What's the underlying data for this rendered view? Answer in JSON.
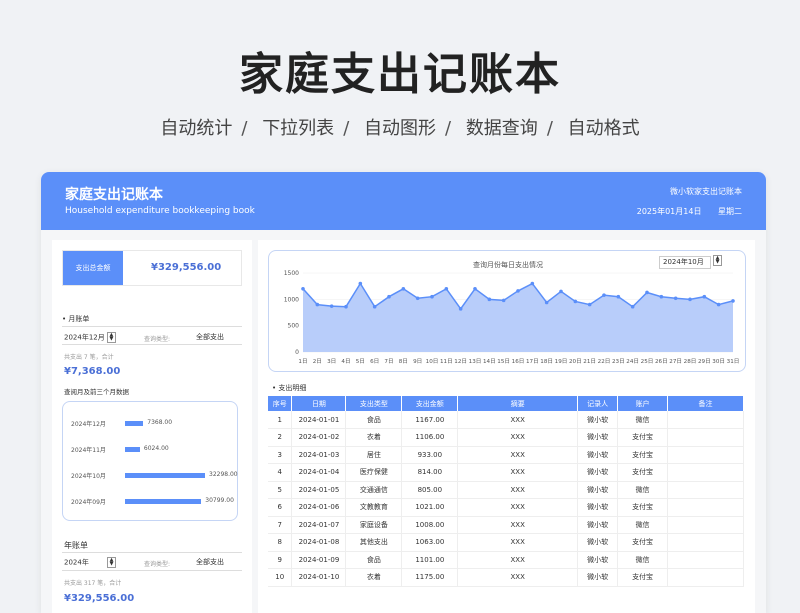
{
  "hero": {
    "title": "家庭支出记账本",
    "tags": [
      "自动统计",
      "下拉列表",
      "自动图形",
      "数据查询",
      "自动格式"
    ]
  },
  "header": {
    "title": "家庭支出记账本",
    "subtitle": "Household expenditure bookkeeping book",
    "brand": "微小软家支出记账本",
    "date": "2025年01月14日",
    "weekday": "星期二"
  },
  "left": {
    "total_label": "支出总金额",
    "total_value": "¥329,556.00",
    "monthly": {
      "title": "月账单",
      "period": "2024年12月",
      "query_label": "查询类型:",
      "query_value": "全部支出",
      "summary": "共支出 7 笔，合计",
      "amount": "¥7,368.00",
      "recent_title": "查阅月及前三个月数据"
    },
    "recent_months": [
      {
        "label": "2024年12月",
        "value": "7368.00",
        "amount": 7368
      },
      {
        "label": "2024年11月",
        "value": "6024.00",
        "amount": 6024
      },
      {
        "label": "2024年10月",
        "value": "32298.00",
        "amount": 32298
      },
      {
        "label": "2024年09月",
        "value": "30799.00",
        "amount": 30799
      }
    ],
    "yearly": {
      "title": "年账单",
      "period": "2024年",
      "query_label": "查询类型:",
      "query_value": "全部支出",
      "summary": "共支出 317 笔，合计",
      "amount": "¥329,556.00"
    }
  },
  "right": {
    "chart_title": "查询月份每日支出情况",
    "month_select": "2024年10月",
    "table_title": "支出明细",
    "columns": [
      "序号",
      "日期",
      "支出类型",
      "支出金额",
      "摘要",
      "记录人",
      "账户",
      "备注"
    ],
    "rows": [
      [
        "1",
        "2024-01-01",
        "食品",
        "1167.00",
        "XXX",
        "微小软",
        "微信",
        ""
      ],
      [
        "2",
        "2024-01-02",
        "衣着",
        "1106.00",
        "XXX",
        "微小软",
        "支付宝",
        ""
      ],
      [
        "3",
        "2024-01-03",
        "居住",
        "933.00",
        "XXX",
        "微小软",
        "支付宝",
        ""
      ],
      [
        "4",
        "2024-01-04",
        "医疗保健",
        "814.00",
        "XXX",
        "微小软",
        "支付宝",
        ""
      ],
      [
        "5",
        "2024-01-05",
        "交通通信",
        "805.00",
        "XXX",
        "微小软",
        "微信",
        ""
      ],
      [
        "6",
        "2024-01-06",
        "文教教育",
        "1021.00",
        "XXX",
        "微小软",
        "支付宝",
        ""
      ],
      [
        "7",
        "2024-01-07",
        "家庭设备",
        "1008.00",
        "XXX",
        "微小软",
        "微信",
        ""
      ],
      [
        "8",
        "2024-01-08",
        "其他支出",
        "1063.00",
        "XXX",
        "微小软",
        "支付宝",
        ""
      ],
      [
        "9",
        "2024-01-09",
        "食品",
        "1101.00",
        "XXX",
        "微小软",
        "微信",
        ""
      ],
      [
        "10",
        "2024-01-10",
        "衣着",
        "1175.00",
        "XXX",
        "微小软",
        "支付宝",
        ""
      ]
    ]
  },
  "chart_data": {
    "type": "area",
    "title": "查询月份每日支出情况",
    "x": [
      "1日",
      "2日",
      "3日",
      "4日",
      "5日",
      "6日",
      "7日",
      "8日",
      "9日",
      "10日",
      "11日",
      "12日",
      "13日",
      "14日",
      "15日",
      "16日",
      "17日",
      "18日",
      "19日",
      "20日",
      "21日",
      "22日",
      "23日",
      "24日",
      "25日",
      "26日",
      "27日",
      "28日",
      "29日",
      "30日",
      "31日"
    ],
    "values": [
      1200,
      900,
      870,
      860,
      1300,
      860,
      1050,
      1200,
      1020,
      1050,
      1200,
      820,
      1200,
      1000,
      980,
      1160,
      1300,
      940,
      1150,
      960,
      900,
      1080,
      1050,
      860,
      1130,
      1050,
      1020,
      1000,
      1050,
      900,
      970
    ],
    "ylim": [
      0,
      1500
    ],
    "yticks": [
      0,
      500,
      1000,
      1500
    ],
    "color": "#5b8ff9",
    "fill": "#b8cdfa"
  }
}
